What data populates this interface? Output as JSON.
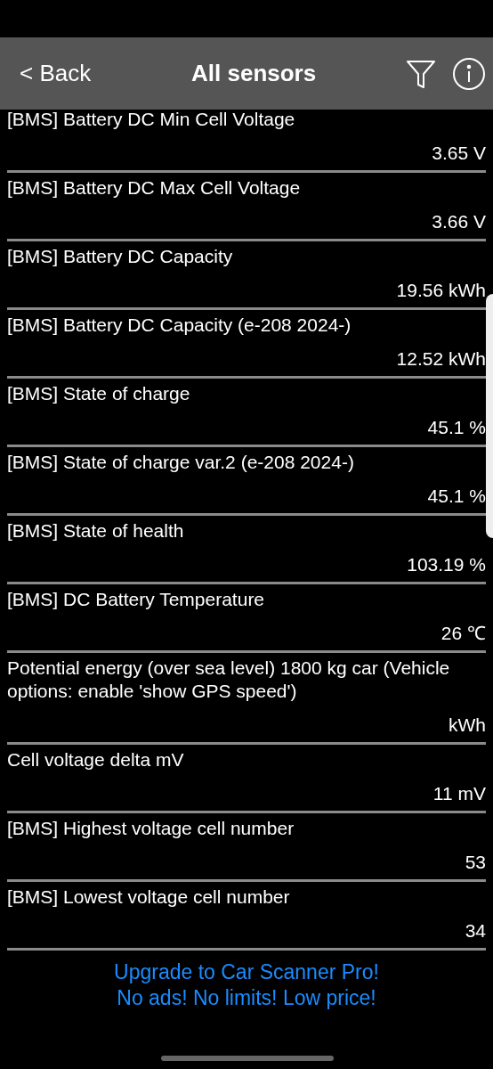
{
  "header": {
    "back": "< Back",
    "title": "All sensors"
  },
  "sensors": [
    {
      "name": "[BMS] Battery DC Min Cell Voltage",
      "value": "3.65 V"
    },
    {
      "name": "[BMS] Battery DC Max Cell Voltage",
      "value": "3.66 V"
    },
    {
      "name": "[BMS] Battery DC Capacity",
      "value": "19.56 kWh"
    },
    {
      "name": "[BMS] Battery DC Capacity (e-208 2024-)",
      "value": "12.52 kWh"
    },
    {
      "name": "[BMS] State of charge",
      "value": "45.1 %"
    },
    {
      "name": "[BMS] State of charge var.2 (e-208 2024-)",
      "value": "45.1 %"
    },
    {
      "name": "[BMS] State of health",
      "value": "103.19 %"
    },
    {
      "name": "[BMS] DC Battery Temperature",
      "value": "26 ℃"
    },
    {
      "name": "Potential energy (over sea level) 1800 kg car (Vehicle options: enable 'show GPS speed')",
      "value": "kWh"
    },
    {
      "name": "Cell voltage delta mV",
      "value": "11 mV"
    },
    {
      "name": "[BMS] Highest voltage cell number",
      "value": "53"
    },
    {
      "name": "[BMS] Lowest voltage cell number",
      "value": "34"
    }
  ],
  "promo": [
    "Upgrade to Car Scanner Pro!",
    "No ads! No limits! Low price!"
  ]
}
